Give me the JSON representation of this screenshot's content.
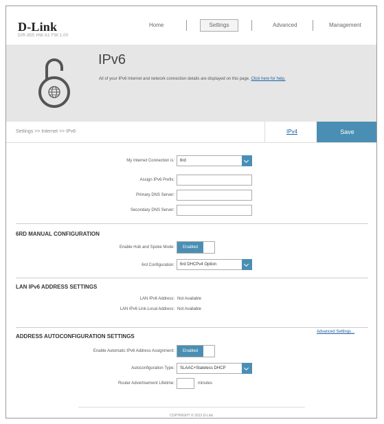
{
  "header": {
    "brand": "D-Link",
    "model_info": "DIR-855  HW:A1  FW:1.00",
    "nav": [
      "Home",
      "Settings",
      "Advanced",
      "Management"
    ]
  },
  "banner": {
    "title": "IPv6",
    "description": "All of your IPv6 Internet and network connection details are displayed on this page.",
    "help_link": "Click here for help."
  },
  "toolbar": {
    "breadcrumb": "Settings >> Internet >> IPv6",
    "ipv4_label": "IPv4",
    "save_label": "Save"
  },
  "connection": {
    "type_label": "My Internet Connection is:",
    "type_value": "6rd",
    "assign_prefix_label": "Assign IPv6 Prefix:",
    "assign_prefix_value": "",
    "primary_dns_label": "Primary DNS Server:",
    "primary_dns_value": "",
    "secondary_dns_label": "Secondary DNS Server:",
    "secondary_dns_value": ""
  },
  "sixrd": {
    "title": "6RD MANUAL CONFIGURATION",
    "hub_spoke_label": "Enable Hub and Spoke Mode:",
    "hub_spoke_state": "Enabled",
    "config_label": "6rd Configuration:",
    "config_value": "6rd DHCPv4 Option"
  },
  "lan": {
    "title": "LAN IPv6 ADDRESS SETTINGS",
    "address_label": "LAN IPv6 Address:",
    "address_value": "Not Available",
    "link_local_label": "LAN IPv6 Link-Local Address:",
    "link_local_value": "Not Available",
    "advanced_link": "Advanced Settings..."
  },
  "autoconf": {
    "title": "ADDRESS AUTOCONFIGURATION SETTINGS",
    "enable_label": "Enable Automatic IPv6 Address Assignment:",
    "enable_state": "Enabled",
    "type_label": "Autoconfiguration Type:",
    "type_value": "SLAAC+Stateless DHCP",
    "lifetime_label": "Router Advertisement Lifetime:",
    "lifetime_value": "",
    "lifetime_unit": "minutes"
  },
  "footer": {
    "copyright": "COPYRIGHT © 2013 D-Link"
  },
  "colors": {
    "accent": "#4a8fb3",
    "banner_bg": "#e6e6e6",
    "link": "#1a5fa0"
  }
}
